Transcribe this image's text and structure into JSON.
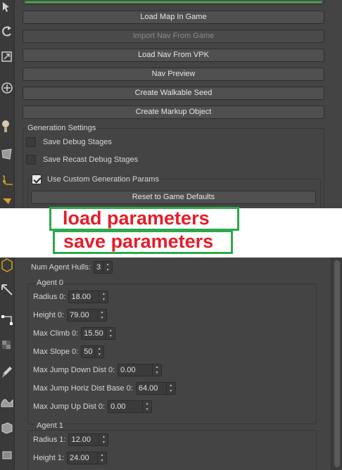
{
  "buttons": {
    "load_map": "Load Map In Game",
    "import_nav": "Import Nav From Game",
    "load_nav_vpk": "Load Nav From VPK",
    "nav_preview": "Nav Preview",
    "create_walkable_seed": "Create Walkable Seed",
    "create_markup_object": "Create Markup Object"
  },
  "generation_settings": {
    "title": "Generation Settings",
    "save_debug_stages": "Save Debug Stages",
    "save_recast_debug_stages": "Save Recast Debug Stages",
    "use_custom_params": "Use Custom Generation Params",
    "reset_defaults": "Reset to Game Defaults"
  },
  "overlays": {
    "load_parameters": "load parameters",
    "save_parameters": "save parameters"
  },
  "agents": {
    "num_hulls_label": "Num Agent Hulls:",
    "num_hulls_value": "3",
    "agent0": {
      "title": "Agent 0",
      "radius_label": "Radius 0:",
      "radius_value": "18.00",
      "height_label": "Height 0:",
      "height_value": "79.00",
      "max_climb_label": "Max Climb 0:",
      "max_climb_value": "15.50",
      "max_slope_label": "Max Slope 0:",
      "max_slope_value": "50",
      "jump_down_label": "Max Jump Down Dist 0:",
      "jump_down_value": "0.00",
      "jump_horiz_label": "Max Jump Horiz Dist Base 0:",
      "jump_horiz_value": "64.00",
      "jump_up_label": "Max Jump Up Dist 0:",
      "jump_up_value": "0.00"
    },
    "agent1": {
      "title": "Agent 1",
      "radius_label": "Radius 1:",
      "radius_value": "12.00",
      "height_label": "Height 1:",
      "height_value": "24.00"
    }
  },
  "colors": {
    "panel_bg": "#444444",
    "overlay_border": "#2ea84a",
    "overlay_text": "#e41e2b",
    "accent_green": "#33c233"
  }
}
